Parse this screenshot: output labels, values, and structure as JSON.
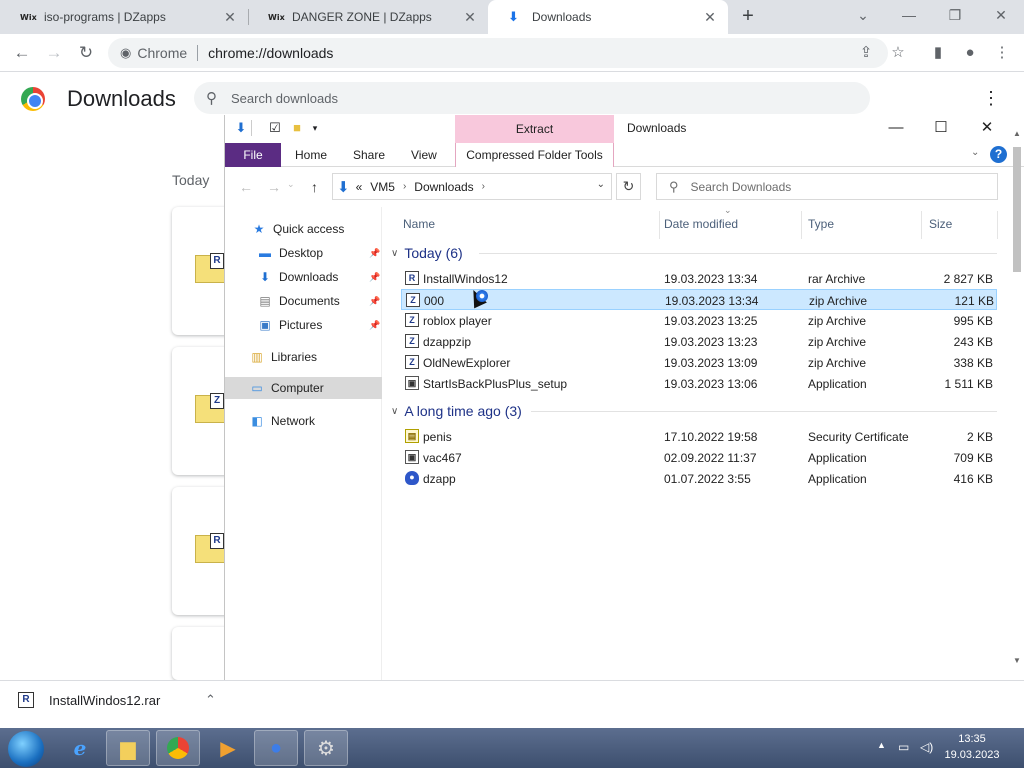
{
  "chrome": {
    "tabs": [
      {
        "favicon": "Wix",
        "label": "iso-programs | DZapps"
      },
      {
        "favicon": "Wix",
        "label": "DANGER ZONE | DZapps"
      },
      {
        "favicon": "download-icon",
        "label": "Downloads"
      }
    ],
    "omnibox": {
      "chip": "Chrome",
      "url": "chrome://downloads"
    }
  },
  "downloads_page": {
    "title": "Downloads",
    "search_placeholder": "Search downloads",
    "section_today": "Today"
  },
  "explorer": {
    "context_tab": "Extract",
    "title": "Downloads",
    "ribbon_tabs": {
      "file": "File",
      "home": "Home",
      "share": "Share",
      "view": "View",
      "tools": "Compressed Folder Tools"
    },
    "address": {
      "prefix": "«",
      "crumbs": [
        "VM5",
        "Downloads"
      ]
    },
    "search_placeholder": "Search Downloads",
    "nav": {
      "quick_access": "Quick access",
      "desktop": "Desktop",
      "downloads": "Downloads",
      "documents": "Documents",
      "pictures": "Pictures",
      "libraries": "Libraries",
      "computer": "Computer",
      "network": "Network"
    },
    "columns": {
      "name": "Name",
      "date": "Date modified",
      "type": "Type",
      "size": "Size"
    },
    "groups": [
      {
        "label": "Today (6)",
        "files": [
          {
            "icon": "R",
            "name": "InstallWindos12",
            "date": "19.03.2023 13:34",
            "type": "rar Archive",
            "size": "2 827 KB"
          },
          {
            "icon": "Z",
            "name": "000",
            "date": "19.03.2023 13:34",
            "type": "zip Archive",
            "size": "121 KB"
          },
          {
            "icon": "Z",
            "name": "roblox player",
            "date": "19.03.2023 13:25",
            "type": "zip Archive",
            "size": "995 KB"
          },
          {
            "icon": "Z",
            "name": "dzappzip",
            "date": "19.03.2023 13:23",
            "type": "zip Archive",
            "size": "243 KB"
          },
          {
            "icon": "Z",
            "name": "OldNewExplorer",
            "date": "19.03.2023 13:09",
            "type": "zip Archive",
            "size": "338 KB"
          },
          {
            "icon": "▣",
            "name": "StartIsBackPlusPlus_setup",
            "date": "19.03.2023 13:06",
            "type": "Application",
            "size": "1 511 KB"
          }
        ]
      },
      {
        "label": "A long time ago (3)",
        "files": [
          {
            "icon": "▤",
            "name": "penis",
            "date": "17.10.2022 19:58",
            "type": "Security Certificate",
            "size": "2 KB"
          },
          {
            "icon": "▣",
            "name": "vac467",
            "date": "02.09.2022 11:37",
            "type": "Application",
            "size": "709 KB"
          },
          {
            "icon": "●",
            "name": "dzapp",
            "date": "01.07.2022 3:55",
            "type": "Application",
            "size": "416 KB"
          }
        ]
      }
    ]
  },
  "download_bar": {
    "icon": "R",
    "filename": "InstallWindos12.rar"
  },
  "taskbar": {
    "time": "13:35",
    "date": "19.03.2023"
  },
  "colors": {
    "file_tab": "#5b2c83",
    "extract_band": "#f8c8dc",
    "selection": "#cce8ff",
    "group_text": "#1e3287"
  }
}
